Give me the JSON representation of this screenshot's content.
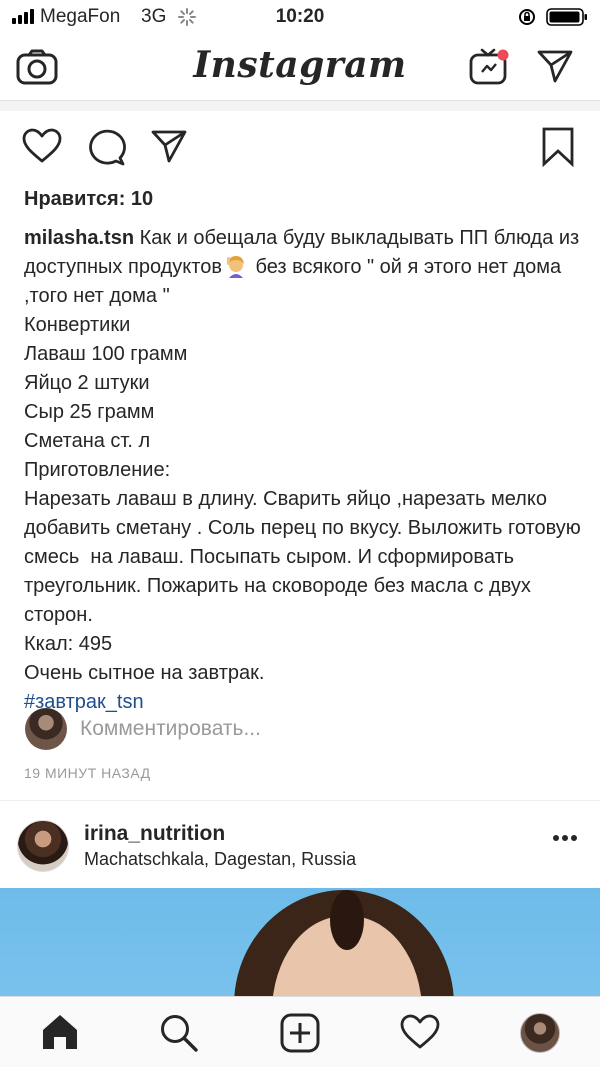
{
  "status_bar": {
    "carrier": "MegaFon",
    "network": "3G",
    "time": "10:20"
  },
  "header": {
    "brand": "Instagram",
    "icons": [
      "camera-icon",
      "igtv-icon",
      "direct-send-icon"
    ],
    "notification_dot_color": "#ed4956"
  },
  "post": {
    "likes_label": "Нравится: 10",
    "caption": {
      "username": "milasha.tsn",
      "text_before_emoji": " Как и обещала буду выкладывать ПП блюда из доступных продуктов",
      "emoji_icon": "person-raising-hand-emoji",
      "text_after_emoji": " без всякого \" ой я этого нет дома ,того нет дома \"",
      "lines": [
        "Конвертики",
        "Лаваш 100 грамм",
        "Яйцо 2 штуки",
        "Сыр 25 грамм",
        "Сметана ст. л",
        "Приготовление:",
        "Нарезать лаваш в длину. Сварить яйцо ,нарезать мелко добавить сметану . Соль перец по вкусу. Выложить готовую смесь  на лаваш. Посыпать сыром. И сформировать треугольник. Пожарить на сковороде без масла с двух сторон.",
        "Ккал: 495",
        "Очень сытное на завтрак."
      ],
      "hashtag": "#завтрак_tsn"
    },
    "comment_placeholder": "Комментировать...",
    "timestamp": "19 МИНУТ НАЗАД",
    "hashtag_color": "#1f4e8c"
  },
  "next_post": {
    "username": "irina_nutrition",
    "location": "Machatschkala, Dagestan, Russia"
  },
  "tab_bar": {
    "items": [
      "home-icon",
      "search-icon",
      "add-post-icon",
      "heart-icon",
      "profile-avatar"
    ]
  }
}
